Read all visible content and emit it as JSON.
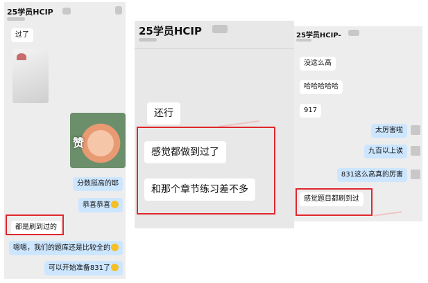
{
  "panel1": {
    "title": "25学员HCIP",
    "messages": [
      "过了",
      "分数挺高的耶",
      "恭喜恭喜",
      "都是刷到过的",
      "嗯嗯，我们的题库还是比较全的",
      "可以开始准备831了"
    ],
    "sticker_text": "赞"
  },
  "panel2": {
    "title": "25学员HCIP",
    "messages": [
      "还行",
      "感觉都做到过了",
      "和那个章节练习差不多"
    ]
  },
  "panel3": {
    "title": "25学员HCIP-",
    "messages": [
      "没这么高",
      "哈哈哈哈哈",
      "917",
      "太厉害啦",
      "九百以上诶",
      "831这么高真的厉害",
      "感觉题目都刷到过"
    ]
  },
  "colors": {
    "highlight": "#e0262d",
    "right_bubble": "#cde6ff",
    "left_bubble": "#ffffff"
  }
}
